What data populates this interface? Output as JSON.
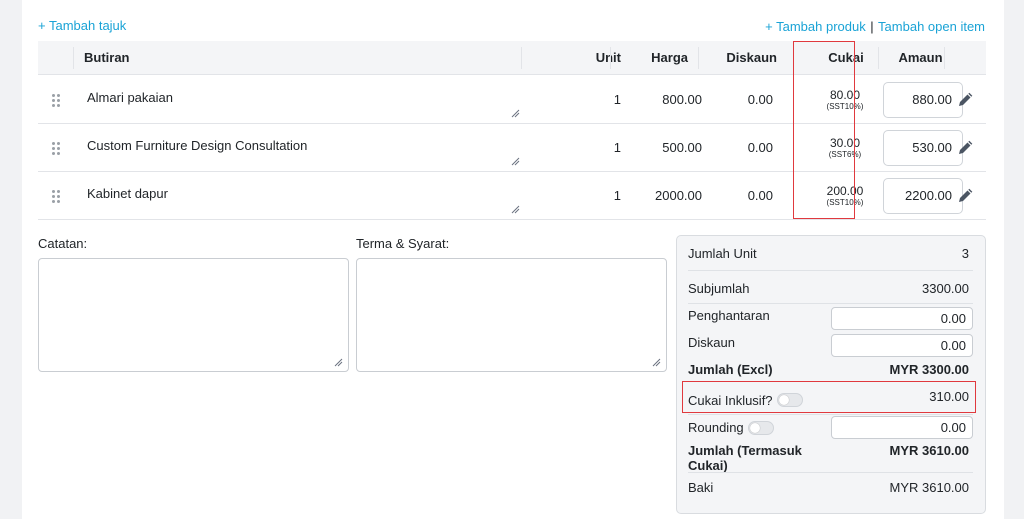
{
  "actions": {
    "add_heading": "+ Tambah tajuk",
    "add_product": "+ Tambah produk",
    "separator": "|",
    "add_open_item": "Tambah open item"
  },
  "table": {
    "headers": {
      "item": "Butiran",
      "unit": "Unit",
      "price": "Harga",
      "discount": "Diskaun",
      "tax": "Cukai",
      "amount": "Amaun"
    },
    "rows": [
      {
        "name": "Almari pakaian",
        "unit": "1",
        "price": "800.00",
        "discount": "0.00",
        "tax": "80.00",
        "tax_code": "(SST10%)",
        "amount": "880.00"
      },
      {
        "name": "Custom Furniture Design Consultation",
        "unit": "1",
        "price": "500.00",
        "discount": "0.00",
        "tax": "30.00",
        "tax_code": "(SST6%)",
        "amount": "530.00"
      },
      {
        "name": "Kabinet dapur",
        "unit": "1",
        "price": "2000.00",
        "discount": "0.00",
        "tax": "200.00",
        "tax_code": "(SST10%)",
        "amount": "2200.00"
      }
    ]
  },
  "notes": {
    "label": "Catatan:",
    "value": ""
  },
  "terms": {
    "label": "Terma & Syarat:",
    "value": ""
  },
  "summary": {
    "total_units_label": "Jumlah Unit",
    "total_units": "3",
    "subtotal_label": "Subjumlah",
    "subtotal": "3300.00",
    "shipping_label": "Penghantaran",
    "shipping": "0.00",
    "discount_label": "Diskaun",
    "discount": "0.00",
    "total_excl_label": "Jumlah (Excl)",
    "total_excl": "MYR 3300.00",
    "tax_inclusive_label": "Cukai Inklusif?",
    "tax_inclusive_value": "310.00",
    "rounding_label": "Rounding",
    "rounding": "0.00",
    "total_incl_label_1": "Jumlah (Termasuk",
    "total_incl_label_2": "Cukai)",
    "total_incl": "MYR 3610.00",
    "balance_label": "Baki",
    "balance": "MYR 3610.00"
  },
  "colors": {
    "accent": "#1aa3d6",
    "highlight": "#e0393e"
  }
}
